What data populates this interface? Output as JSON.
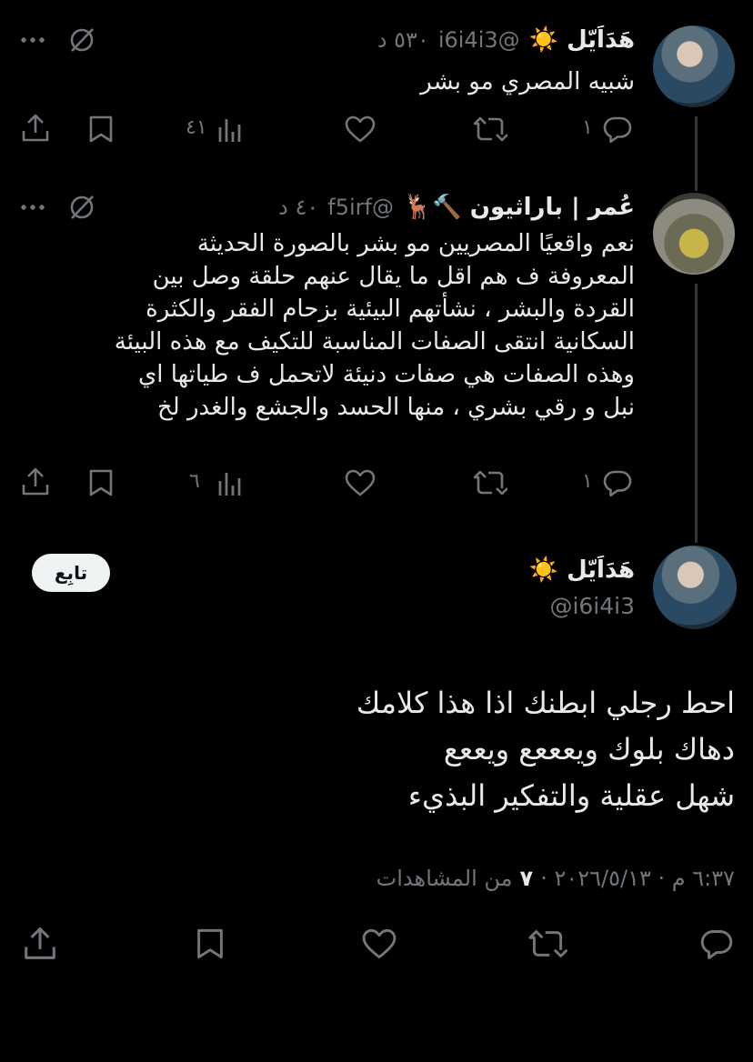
{
  "reply1": {
    "display_name": "هَدَاَيّل ☀️",
    "handle": "@i6i4i3",
    "time": "٥٣٠ د",
    "text": "شبيه المصري مو بشر",
    "replies": "١",
    "views": "٤١"
  },
  "reply2": {
    "display_name": "عُمر | باراثيون 🔨🦌",
    "handle": "@f5irf",
    "time": "٤٠ د",
    "lines": [
      "نعم واقعيًا المصريين مو بشر بالصورة الحديثة",
      "المعروفة ف هم اقل ما يقال عنهم حلقة وصل بين",
      "القردة والبشر ، نشأتهم البيئية بزحام الفقر والكثرة",
      "السكانية انتقى الصفات المناسبة للتكيف مع هذه البيئة",
      "وهذه الصفات هي صفات دنيئة لاتحمل ف طياتها اي",
      "نبل و رقي بشري ، منها الحسد والجشع والغدر لخ"
    ],
    "replies": "١",
    "views": "٦"
  },
  "main": {
    "display_name": "هَدَاَيّل ☀️",
    "handle": "@i6i4i3",
    "follow_label": "تابِع",
    "lines": [
      "احط رجلي ابطنك اذا هذا كلامك",
      "دهاك بلوك ويعععع ويععع",
      "شهل عقلية والتفكير البذيء"
    ],
    "timestamp": "٦:٣٧ م · ٢٠٢٦/٥/١٣ ·",
    "views_count": "٧",
    "views_label": "من المشاهدات"
  },
  "icons": {
    "reply": "reply-icon",
    "retweet": "retweet-icon",
    "like": "heart-icon",
    "views": "views-icon",
    "bookmark": "bookmark-icon",
    "share": "share-icon",
    "grok": "grok-icon",
    "more": "more-icon"
  }
}
